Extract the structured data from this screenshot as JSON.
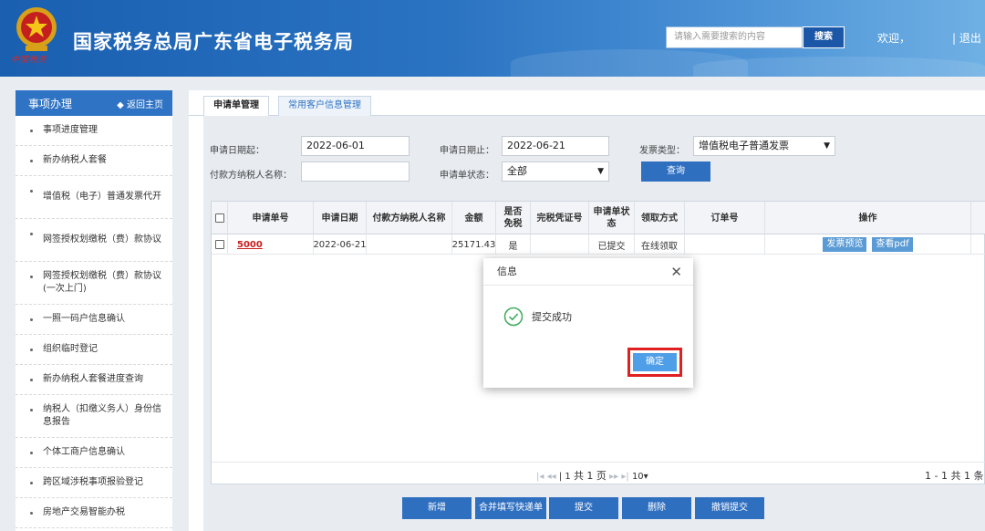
{
  "header": {
    "emblem_text": "中国税务",
    "title": "国家税务总局广东省电子税务局",
    "search_placeholder": "请输入需要搜索的内容",
    "search_button": "搜索",
    "welcome": "欢迎，",
    "logout": "| 退出"
  },
  "sidebar": {
    "title": "事项办理",
    "back": "◆ 返回主页",
    "items": [
      {
        "label": "事项进度管理"
      },
      {
        "label": "新办纳税人套餐"
      },
      {
        "label": "增值税（电子）普通发票代开"
      },
      {
        "label": "网签授权划缴税（费）款协议"
      },
      {
        "label": "网签授权划缴税（费）款协议(一次上门)"
      },
      {
        "label": "一照一码户信息确认"
      },
      {
        "label": "组织临时登记"
      },
      {
        "label": "新办纳税人套餐进度查询"
      },
      {
        "label": "纳税人（扣缴义务人）身份信息报告"
      },
      {
        "label": "个体工商户信息确认"
      },
      {
        "label": "跨区域涉税事项报验登记"
      },
      {
        "label": "房地产交易智能办税"
      }
    ]
  },
  "tabs": [
    {
      "label": "申请单管理"
    },
    {
      "label": "常用客户信息管理"
    }
  ],
  "filters": {
    "start_label": "申请日期起：",
    "start_value": "2022-06-01",
    "end_label": "申请日期止：",
    "end_value": "2022-06-21",
    "type_label": "发票类型：",
    "type_value": "增值税电子普通发票",
    "payer_label": "付款方纳税人名称：",
    "payer_value": "",
    "status_label": "申请单状态：",
    "status_value": "全部",
    "query_button": "查询"
  },
  "table": {
    "headers": [
      "申请单号",
      "申请日期",
      "付款方纳税人名称",
      "金额",
      "是否免税",
      "完税凭证号",
      "申请单状态",
      "领取方式",
      "订单号",
      "操作"
    ],
    "rows": [
      {
        "order_no": "5000",
        "date": "2022-06-21",
        "payer": "",
        "amount": "25171.43",
        "tax_free": "是",
        "voucher": "",
        "status": "已提交",
        "pickup": "在线领取",
        "order": "",
        "op1": "发票预览",
        "op2": "查看pdf"
      }
    ],
    "pager": {
      "page": "1",
      "total_pages": "共 1 页",
      "page_size": "10",
      "count": "1 - 1  共 1 条"
    }
  },
  "actions": [
    "新增",
    "合并填写快递单",
    "提交",
    "删除",
    "撤销提交"
  ],
  "dialog": {
    "title": "信息",
    "message": "提交成功",
    "ok": "确定"
  },
  "colors": {
    "header_blue": "#1a5fb0",
    "sidebar_head": "#2f73c4",
    "button_blue": "#2f6fc0",
    "highlight_red": "#e02020",
    "success_green": "#3daa5c"
  }
}
